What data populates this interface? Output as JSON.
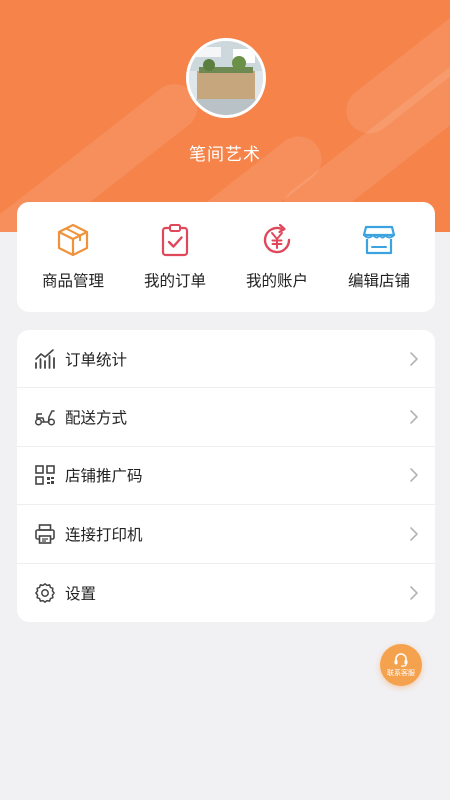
{
  "header": {
    "shop_name": "笔间艺术",
    "avatar_alt": "店铺头像"
  },
  "quick_actions": [
    {
      "label": "商品管理",
      "icon": "package-icon"
    },
    {
      "label": "我的订单",
      "icon": "clipboard-check-icon"
    },
    {
      "label": "我的账户",
      "icon": "yuan-refresh-icon"
    },
    {
      "label": "编辑店铺",
      "icon": "storefront-icon"
    }
  ],
  "menu": [
    {
      "label": "订单统计",
      "icon": "stats-chart-icon"
    },
    {
      "label": "配送方式",
      "icon": "scooter-icon"
    },
    {
      "label": "店铺推广码",
      "icon": "qr-code-icon"
    },
    {
      "label": "连接打印机",
      "icon": "printer-icon"
    },
    {
      "label": "设置",
      "icon": "gear-icon"
    }
  ],
  "support": {
    "label": "联系客服",
    "icon": "headset-icon"
  },
  "colors": {
    "brand_orange": "#f5834a",
    "fab_orange": "#f5a24f",
    "icon_orange": "#f0923a",
    "icon_red": "#e0475b",
    "icon_blue": "#3ba3e0"
  }
}
